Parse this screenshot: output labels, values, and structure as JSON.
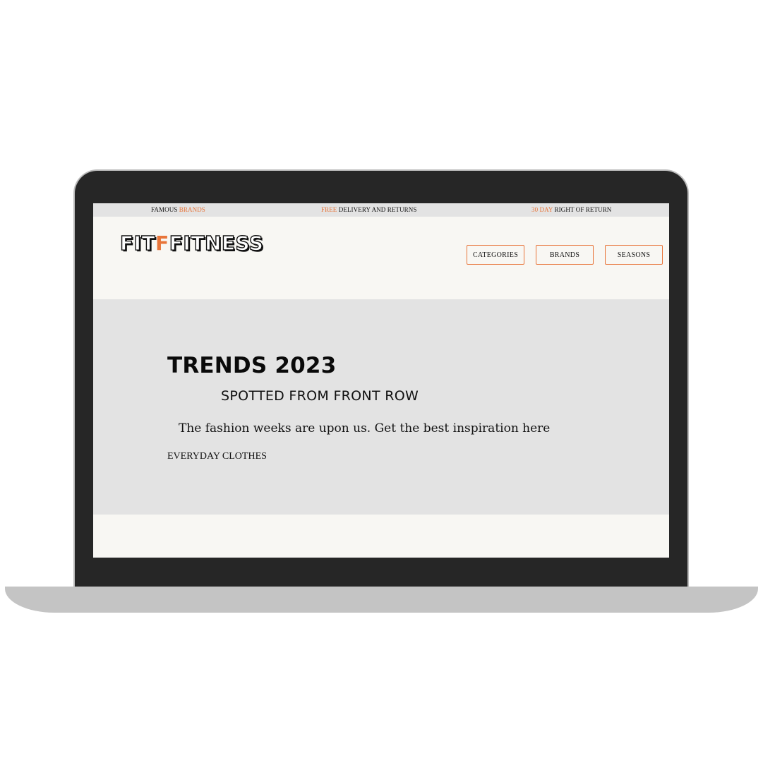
{
  "promo_bar": {
    "items": [
      {
        "lead": "FAMOUS ",
        "accent": "BRANDS",
        "trail": ""
      },
      {
        "lead": "",
        "accent": "FREE",
        "trail": " DELIVERY AND RETURNS"
      },
      {
        "lead": "",
        "accent": "30 DAY",
        "trail": " RIGHT OF RETURN"
      }
    ]
  },
  "header": {
    "logo": {
      "left": "FIT",
      "mark": "F",
      "right": "FITNESS"
    },
    "nav": [
      "CATEGORIES",
      "BRANDS",
      "SEASONS"
    ]
  },
  "hero": {
    "title": "TRENDS 2023",
    "subtitle": "SPOTTED FROM FRONT ROW",
    "text": "The fashion weeks are upon us. Get the best inspiration here",
    "link": "EVERYDAY CLOTHES"
  },
  "colors": {
    "accent": "#e8753a",
    "hero_background": "#e3e3e3",
    "page_background": "#f8f7f3",
    "laptop_frame": "#262626"
  }
}
